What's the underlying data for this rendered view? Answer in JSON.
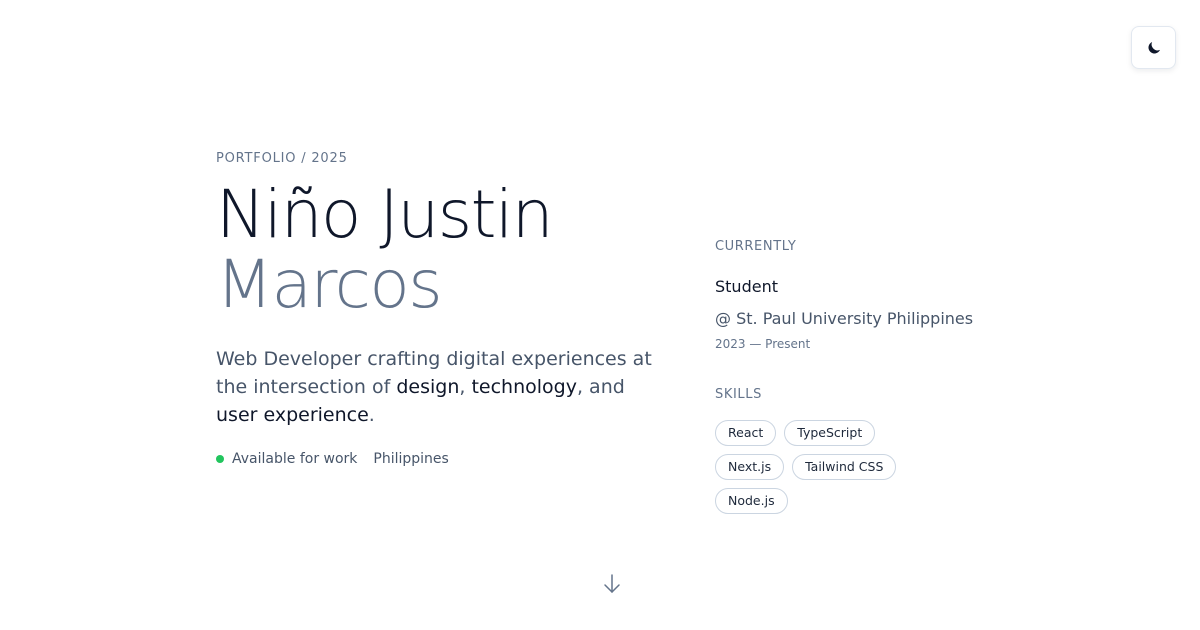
{
  "header": {
    "eyebrow": "PORTFOLIO / 2025",
    "theme_toggle_icon": "moon-icon"
  },
  "hero": {
    "first_name": "Niño Justin",
    "last_name": "Marcos",
    "tagline": {
      "prefix": "Web Developer crafting digital experiences at the intersection of ",
      "highlight1": "design",
      "sep1": ", ",
      "highlight2": "technology",
      "sep2": ", and ",
      "highlight3": "user experience",
      "suffix": "."
    },
    "status_text": "Available for work",
    "location": "Philippines"
  },
  "currently": {
    "label": "CURRENTLY",
    "role": "Student",
    "organization": "@ St. Paul University Philippines",
    "period": "2023 — Present"
  },
  "skills": {
    "label": "SKILLS",
    "items": [
      "React",
      "TypeScript",
      "Next.js",
      "Tailwind CSS",
      "Node.js"
    ]
  },
  "scroll_icon": "arrow-down-icon",
  "colors": {
    "status_dot": "#22c55e",
    "primary_text": "#0f172a",
    "muted_text": "#64748b"
  }
}
